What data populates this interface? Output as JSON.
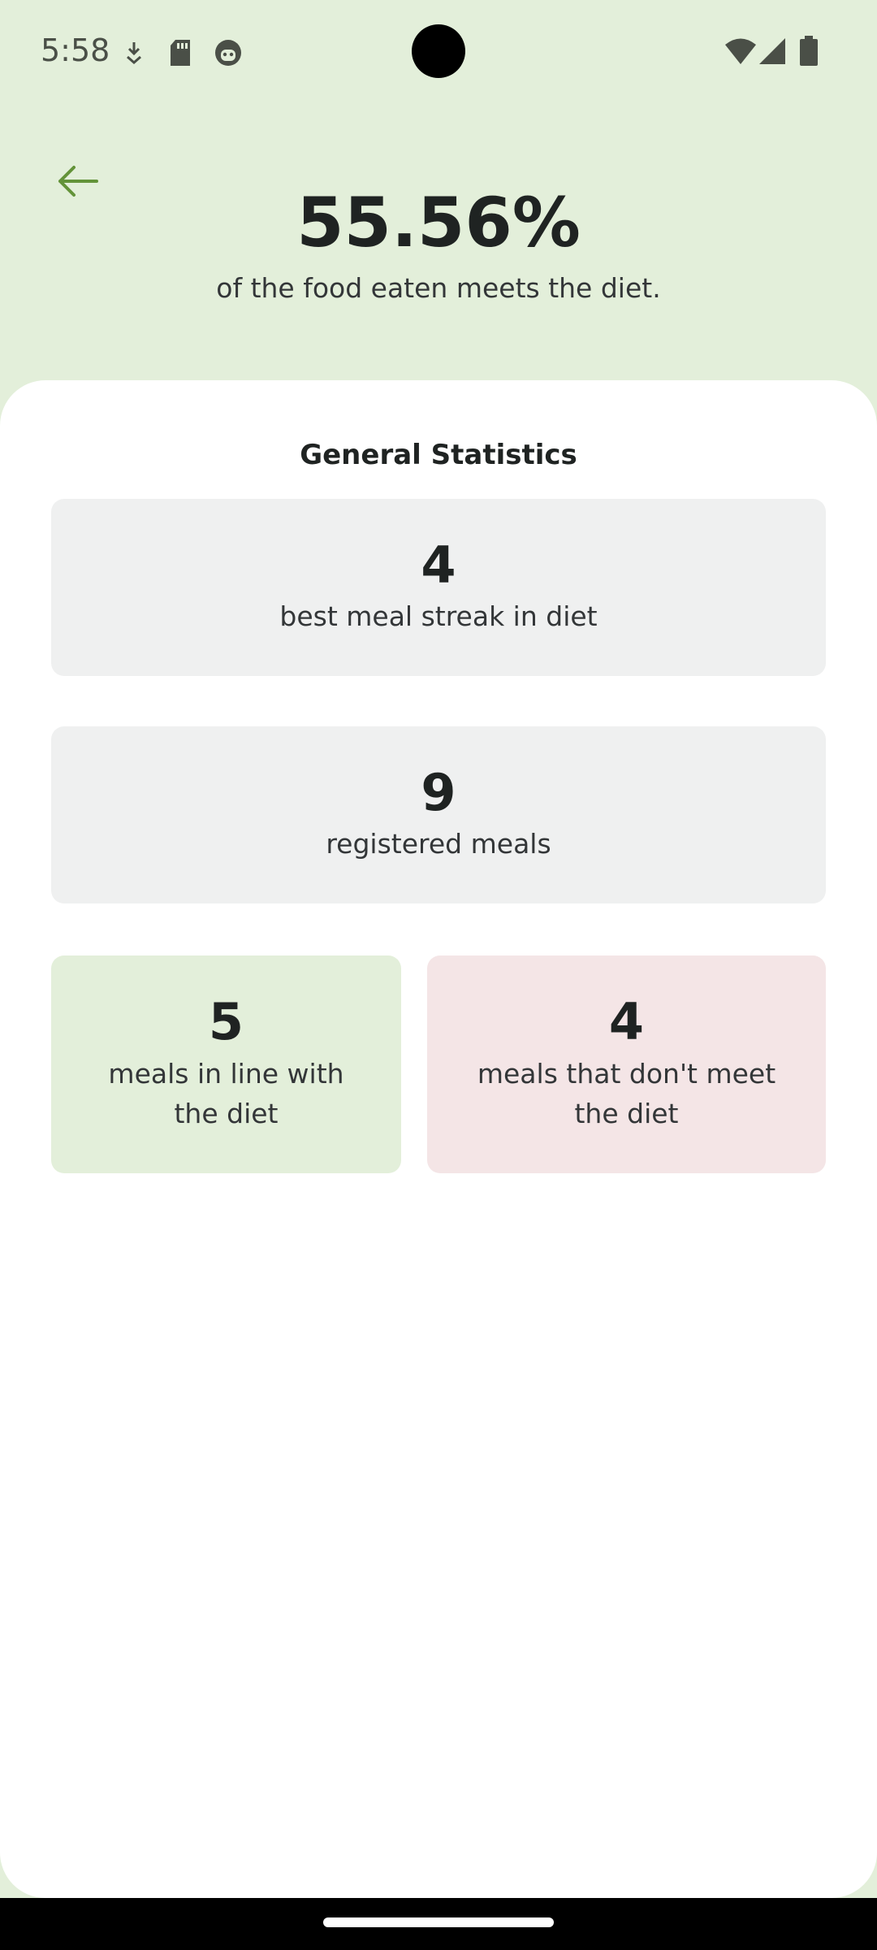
{
  "status_bar": {
    "time": "5:58",
    "left_icons": [
      "shield-download-icon",
      "sd-card-icon",
      "face-icon"
    ],
    "right_icons": [
      "wifi-icon",
      "signal-icon",
      "battery-icon"
    ]
  },
  "header": {
    "back_icon": "arrow-left-icon",
    "percentage": "55.56%",
    "subtitle": "of the food eaten meets the diet."
  },
  "statistics": {
    "title": "General Statistics",
    "best_streak": {
      "value": "4",
      "label": "best meal streak in diet"
    },
    "registered": {
      "value": "9",
      "label": "registered meals"
    },
    "in_diet": {
      "value": "5",
      "label": "meals in line with the diet"
    },
    "off_diet": {
      "value": "4",
      "label": "meals that don't meet the diet"
    }
  },
  "colors": {
    "header_bg": "#E3EFDA",
    "accent_green": "#639339",
    "card_gray": "#EFF0F0",
    "card_green": "#E3EFDA",
    "card_red": "#F4E5E6"
  }
}
